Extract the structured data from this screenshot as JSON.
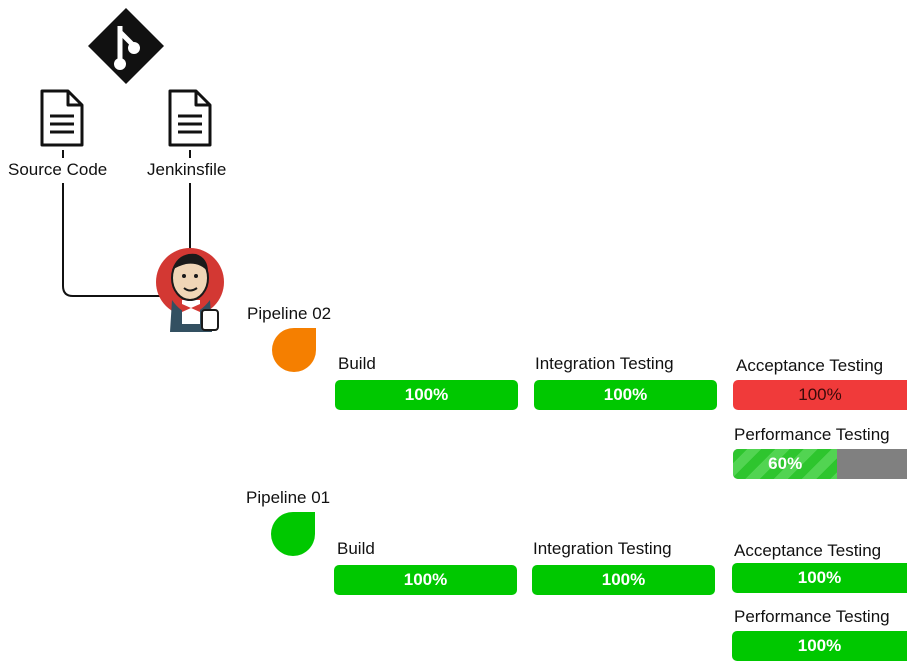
{
  "colors": {
    "success": "#00c800",
    "failed": "#f03a3a",
    "running": "#f57f00",
    "pending": "#808080"
  },
  "sources": {
    "repo_icon": "git-icon",
    "source_code": "Source Code",
    "jenkinsfile": "Jenkinsfile",
    "server_icon": "jenkins-icon"
  },
  "pipelines": [
    {
      "name": "Pipeline 02",
      "status": "running",
      "stages": [
        {
          "name": "Build",
          "label": "100%",
          "progress": 1.0,
          "state": "success"
        },
        {
          "name": "Integration Testing",
          "label": "100%",
          "progress": 1.0,
          "state": "success"
        },
        {
          "name": "Acceptance Testing",
          "label": "100%",
          "progress": 1.0,
          "state": "failed"
        },
        {
          "name": "Performance Testing",
          "label": "60%",
          "progress": 0.6,
          "state": "running"
        }
      ]
    },
    {
      "name": "Pipeline 01",
      "status": "success",
      "stages": [
        {
          "name": "Build",
          "label": "100%",
          "progress": 1.0,
          "state": "success"
        },
        {
          "name": "Integration Testing",
          "label": "100%",
          "progress": 1.0,
          "state": "success"
        },
        {
          "name": "Acceptance Testing",
          "label": "100%",
          "progress": 1.0,
          "state": "success"
        },
        {
          "name": "Performance Testing",
          "label": "100%",
          "progress": 1.0,
          "state": "success"
        }
      ]
    }
  ]
}
